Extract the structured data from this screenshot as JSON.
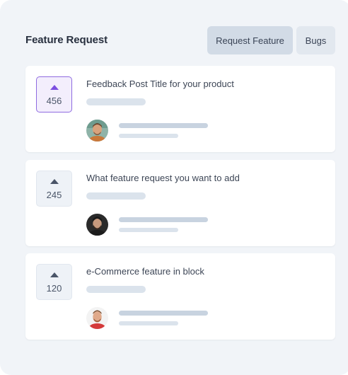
{
  "header": {
    "title": "Feature Request",
    "buttons": [
      {
        "label": "Request Feature",
        "selected": true
      },
      {
        "label": "Bugs",
        "selected": false
      }
    ]
  },
  "posts": [
    {
      "title": "Feedback Post Title for your product",
      "votes": "456",
      "voted": true
    },
    {
      "title": "What feature request you want to add",
      "votes": "245",
      "voted": false
    },
    {
      "title": "e-Commerce feature in block",
      "votes": "120",
      "voted": false
    }
  ],
  "colors": {
    "accent": "#7c4fe0",
    "panel_bg": "#f1f4f8",
    "selected_button_bg": "#d2dbe6"
  },
  "icons": {
    "upvote": "caret-up-icon"
  }
}
